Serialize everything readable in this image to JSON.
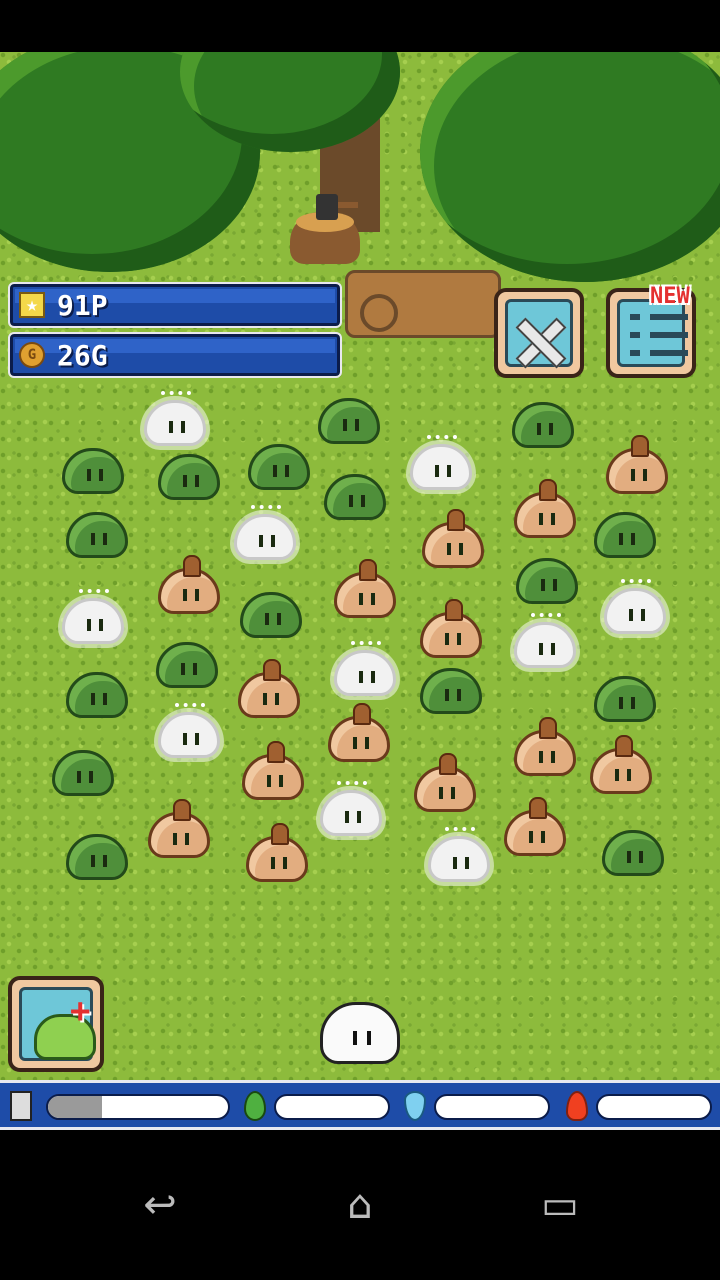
{
  "hud": {
    "points": "91P",
    "gold": "26G"
  },
  "quest_button": {
    "badge": "NEW"
  },
  "meters": {
    "home_level": 0.3,
    "grass_level": 0,
    "water_level": 0,
    "fire_level": 0
  },
  "icons": {
    "points": "star-icon",
    "gold": "coin-icon",
    "battle": "crossed-swords-icon",
    "quest": "list-icon",
    "feed": "slime-plus-icon",
    "home": "house-icon",
    "grass": "leaf-icon",
    "water": "water-drop-icon",
    "fire": "fire-icon",
    "back": "back-arrow-icon",
    "home_nav": "home-icon",
    "recents": "recents-icon"
  },
  "colors": {
    "hud_blue": "#1e4ca8",
    "grass": "#8dbb3c",
    "badge_red": "#e43030"
  }
}
